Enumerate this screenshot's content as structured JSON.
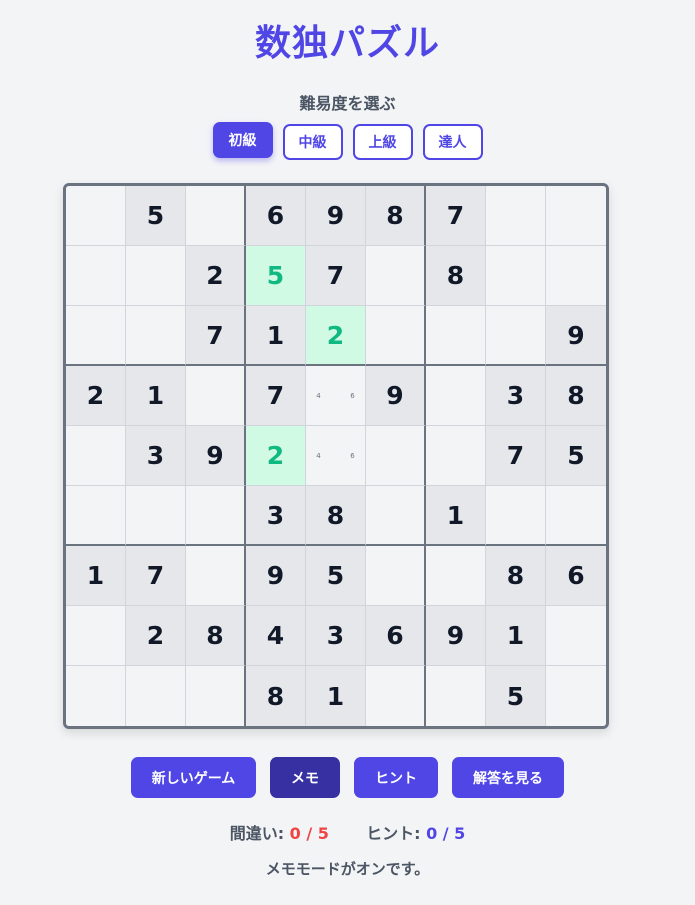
{
  "title": "数独パズル",
  "difficulty": {
    "label": "難易度を選ぶ",
    "options": [
      "初級",
      "中級",
      "上級",
      "達人"
    ],
    "selected": "初級"
  },
  "board": {
    "rows": [
      [
        "",
        "5",
        "",
        "6",
        "9",
        "8",
        "7",
        "",
        ""
      ],
      [
        "",
        "",
        "2",
        "5",
        "7",
        "",
        "8",
        "",
        ""
      ],
      [
        "",
        "",
        "7",
        "1",
        "2",
        "",
        "",
        "",
        "9"
      ],
      [
        "2",
        "1",
        "",
        "7",
        "",
        "9",
        "",
        "3",
        "8"
      ],
      [
        "",
        "3",
        "9",
        "2",
        "",
        "",
        "",
        "7",
        "5"
      ],
      [
        "",
        "",
        "",
        "3",
        "8",
        "",
        "1",
        "",
        ""
      ],
      [
        "1",
        "7",
        "",
        "9",
        "5",
        "",
        "",
        "8",
        "6"
      ],
      [
        "",
        "2",
        "8",
        "4",
        "3",
        "6",
        "9",
        "1",
        ""
      ],
      [
        "",
        "",
        "",
        "8",
        "1",
        "",
        "",
        "5",
        ""
      ]
    ],
    "given": [
      [
        0,
        1,
        0,
        1,
        1,
        1,
        1,
        0,
        0
      ],
      [
        0,
        0,
        1,
        0,
        1,
        0,
        1,
        0,
        0
      ],
      [
        0,
        0,
        1,
        1,
        0,
        0,
        0,
        0,
        1
      ],
      [
        1,
        1,
        0,
        1,
        0,
        1,
        0,
        1,
        1
      ],
      [
        0,
        1,
        1,
        0,
        0,
        0,
        0,
        1,
        1
      ],
      [
        0,
        0,
        0,
        1,
        1,
        0,
        1,
        0,
        0
      ],
      [
        1,
        1,
        0,
        1,
        1,
        0,
        0,
        1,
        1
      ],
      [
        0,
        1,
        1,
        1,
        1,
        1,
        1,
        1,
        0
      ],
      [
        0,
        0,
        0,
        1,
        1,
        0,
        0,
        1,
        0
      ]
    ],
    "hint_cells": [
      [
        1,
        3
      ],
      [
        2,
        4
      ],
      [
        4,
        3
      ]
    ],
    "notes": [
      {
        "row": 3,
        "col": 4,
        "values": [
          "",
          "",
          "",
          "4",
          "",
          "6",
          "",
          "",
          ""
        ]
      },
      {
        "row": 4,
        "col": 4,
        "values": [
          "",
          "",
          "",
          "4",
          "",
          "6",
          "",
          "",
          ""
        ]
      }
    ]
  },
  "controls": {
    "new_game": "新しいゲーム",
    "memo": "メモ",
    "hint": "ヒント",
    "show_answer": "解答を見る"
  },
  "stats": {
    "mistakes_label": "間違い:",
    "mistakes_value": "0 / 5",
    "hints_label": "ヒント:",
    "hints_value": "0 / 5"
  },
  "status": "メモモードがオンです。",
  "colors": {
    "accent": "#4f46e5",
    "hint_cell": "#d1fae5",
    "hint_text": "#10b981",
    "error": "#ef4444"
  }
}
